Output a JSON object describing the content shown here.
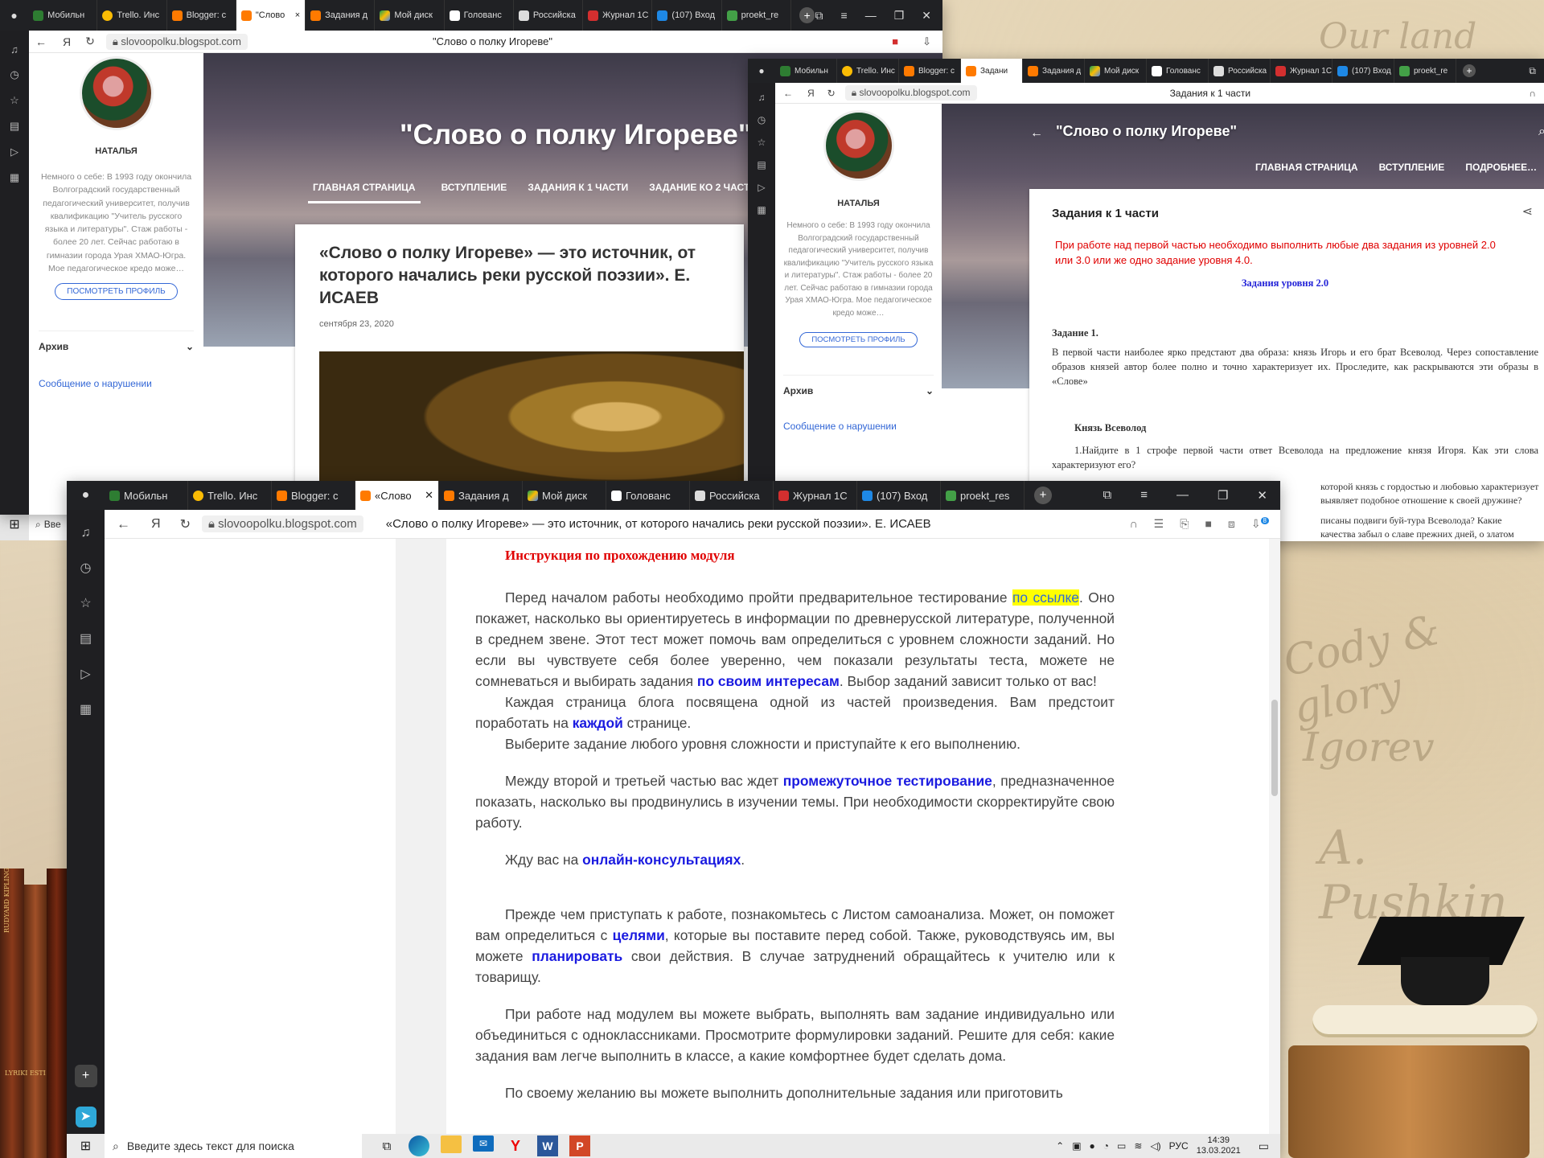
{
  "desktop": {
    "deco_texts": [
      "Our land",
      "Cody & glory",
      "Igorev",
      "A. Pushkin"
    ],
    "books": [
      "RUDYARD KIPLING",
      "LYRIKI ESTI"
    ]
  },
  "window1": {
    "tabs": [
      "Мобильн",
      "Trello. Инс",
      "Blogger: с",
      "\"Слово",
      "Задания д",
      "Мой диск",
      "Голованс",
      "Российска",
      "Журнал 1С",
      "(107) Вход",
      "proekt_re"
    ],
    "url": "slovoopolku.blogspot.com",
    "page_title": "\"Слово о полку Игореве\"",
    "profile": {
      "name": "НАТАЛЬЯ",
      "about": "Немного о себе: В 1993 году окончила Волгоградский государственный педагогический университет, получив квалификацию \"Учитель русского языка и литературы\". Стаж работы - более 20 лет. Сейчас работаю в гимназии города Урая ХМАО-Югра. Мое педагогическое кредо може…",
      "button": "ПОСМОТРЕТЬ ПРОФИЛЬ"
    },
    "archive": "Архив",
    "report": "Сообщение о нарушении",
    "hero_title": "\"Слово о полку Игореве\"",
    "nav": [
      "ГЛАВНАЯ СТРАНИЦА",
      "ВСТУПЛЕНИЕ",
      "ЗАДАНИЯ К 1 ЧАСТИ",
      "ЗАДАНИЕ КО 2 ЧАСТИ"
    ],
    "post_title": "«Слово о полку Игореве» — это источник, от которого начались реки русской поэзии». Е. ИСАЕВ",
    "post_date": "сентября 23, 2020"
  },
  "window2": {
    "tabs": [
      "Мобильн",
      "Trello. Инс",
      "Blogger: с",
      "Задани",
      "Задания д",
      "Мой диск",
      "Голованс",
      "Российска",
      "Журнал 1С",
      "(107) Вход",
      "proekt_re"
    ],
    "url": "slovoopolku.blogspot.com",
    "page_title": "Задания к 1 части",
    "profile": {
      "name": "НАТАЛЬЯ",
      "about": "Немного о себе: В 1993 году окончила Волгоградский государственный педагогический университет, получив квалификацию \"Учитель русского языка и литературы\". Стаж работы - более 20 лет. Сейчас работаю в гимназии города Урая ХМАО-Югра. Мое педагогическое кредо може…",
      "button": "ПОСМОТРЕТЬ ПРОФИЛЬ"
    },
    "archive": "Архив",
    "report": "Сообщение о нарушении",
    "hero_title": "\"Слово о полку Игореве\"",
    "nav": [
      "ГЛАВНАЯ СТРАНИЦА",
      "ВСТУПЛЕНИЕ",
      "ПОДРОБНЕЕ…"
    ],
    "card_title": "Задания к 1 части",
    "red_note": "При работе над первой частью необходимо выполнить любые два задания из  уровней 2.0  или  3.0  или же одно задание уровня 4.0.",
    "level": "Задания уровня 2.0",
    "task1_head": "Задание 1.",
    "task1_text": "В первой части наиболее ярко предстают два образа: князь Игорь и его брат Всеволод. Через сопоставление образов князей автор более полно и точно характеризует их. Проследите, как раскрываются эти образы в «Слове»",
    "prince": "Князь Всеволод",
    "q1": "1.Найдите в 1 строфе первой части ответ Всеволода на предложение князя Игоря. Как эти слова характеризуют его?",
    "q2": "которой князь с гордостью и любовью характеризует выявляет подобное отношение к своей дружине?",
    "q3": "писаны подвиги буй-тура Всеволода? Какие качества забыл о славе прежних дней, о златом черниговском"
  },
  "window3": {
    "tabs": [
      "Мобильн",
      "Trello. Инс",
      "Blogger: с",
      "«Слово",
      "Задания д",
      "Мой диск",
      "Голованс",
      "Российска",
      "Журнал 1С",
      "(107) Вход",
      "proekt_res"
    ],
    "url": "slovoopolku.blogspot.com",
    "page_title": "«Слово о полку Игореве» — это источник, от которого начались реки русской поэзии». Е. ИСАЕВ",
    "download_badge": "8",
    "article": {
      "heading": "Инструкция по прохождению модуля",
      "p1_a": "Перед началом работы необходимо пройти предварительное тестирование ",
      "p1_link": "по ссылке",
      "p1_b": ". Оно покажет, насколько вы ориентируетесь в информации по древнерусской литературе, полученной в среднем звене. Этот тест может помочь вам определиться с уровнем сложности заданий. Но если вы чувствуете себя более уверенно, чем показали результаты теста, можете не сомневаться и выбирать задания ",
      "p1_link2": "по своим интересам",
      "p1_c": ". Выбор заданий зависит только от вас!",
      "p2_a": "Каждая страница блога посвящена одной из частей произведения. Вам предстоит поработать на ",
      "p2_link": "каждой",
      "p2_b": " странице.",
      "p3": "Выберите задание любого уровня сложности и приступайте к его выполнению.",
      "p4_a": "Между второй и третьей частью вас ждет ",
      "p4_link": "промежуточное тестирование",
      "p4_b": ", предназначенное показать, насколько вы продвинулись в изучении темы. При необходимости скорректируйте свою работу.",
      "p5_a": "Жду вас на ",
      "p5_link": "онлайн-консультациях",
      "p5_b": ".",
      "p6_a": "Прежде чем приступать к работе, познакомьтесь с Листом самоанализа. Может, он поможет вам определиться с ",
      "p6_link": "целями",
      "p6_b": ", которые вы поставите перед собой. Также, руководствуясь им, вы можете ",
      "p6_link2": "планировать",
      "p6_c": " свои действия. В случае затруднений обращайтесь к учителю или к товарищу.",
      "p7": "При работе над модулем вы можете выбрать, выполнять вам задание индивидуально или объединиться с одноклассниками. Просмотрите формулировки заданий. Решите для себя: какие задания вам легче выполнить в классе, а какие комфортнее будет сделать дома.",
      "p8": "По своему желанию вы можете выполнить дополнительные задания или приготовить"
    }
  },
  "taskbar_back": {
    "search_placeholder": "Вве"
  },
  "taskbar": {
    "search_placeholder": "Введите здесь текст для поиска",
    "lang": "РУС",
    "time": "14:39",
    "date": "13.03.2021"
  },
  "colors": {
    "accent_blue": "#1a1ae0",
    "accent_red": "#e00000",
    "link_yellow": "#ffff00",
    "dark_chrome": "#202124"
  }
}
